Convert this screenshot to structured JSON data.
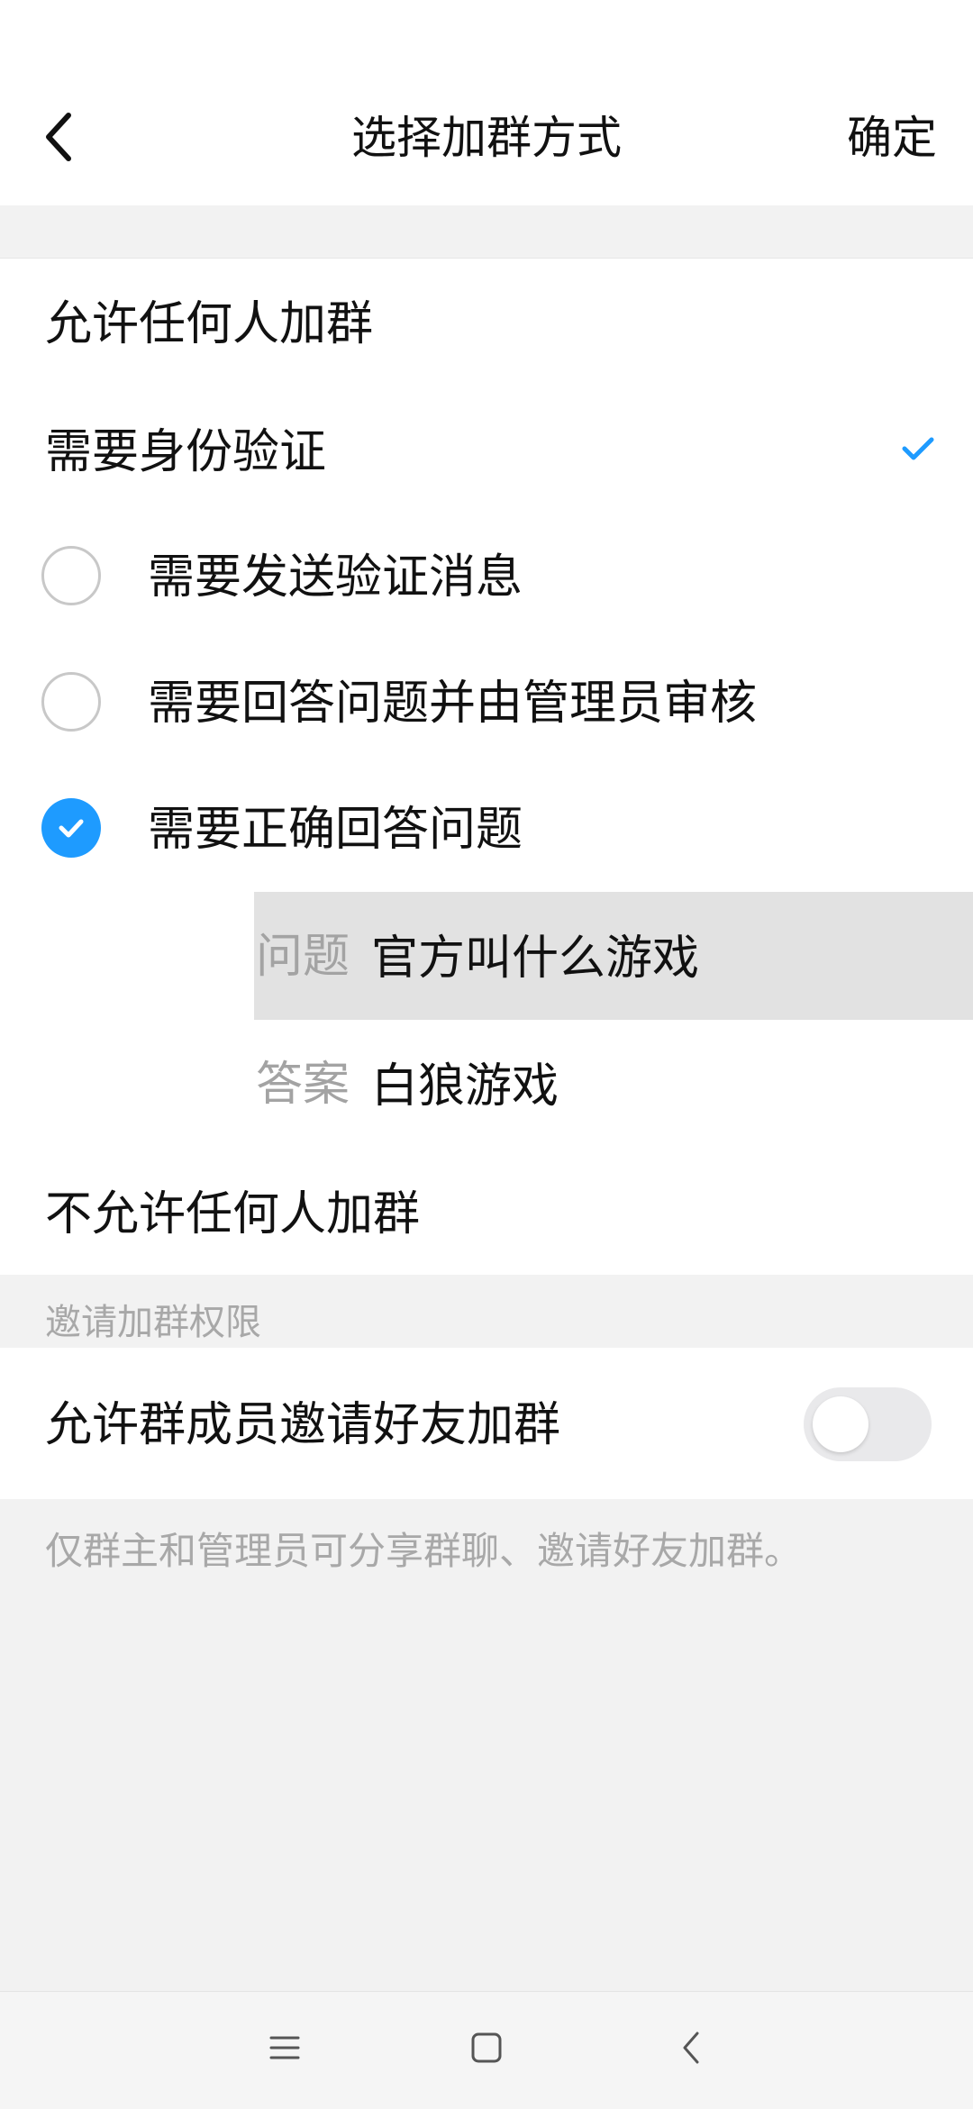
{
  "header": {
    "title": "选择加群方式",
    "confirm_label": "确定"
  },
  "join_options": {
    "allow_anyone": "允许任何人加群",
    "require_verification": "需要身份验证",
    "sub_options": [
      {
        "label": "需要发送验证消息",
        "checked": false
      },
      {
        "label": "需要回答问题并由管理员审核",
        "checked": false
      },
      {
        "label": "需要正确回答问题",
        "checked": true
      }
    ],
    "question_label": "问题",
    "question_value": "官方叫什么游戏",
    "answer_label": "答案",
    "answer_value": "白狼游戏",
    "disallow_all": "不允许任何人加群"
  },
  "invite": {
    "section_header": "邀请加群权限",
    "toggle_label": "允许群成员邀请好友加群",
    "toggle_on": false,
    "note": "仅群主和管理员可分享群聊、邀请好友加群。"
  },
  "colors": {
    "accent": "#1e9bff",
    "background": "#f2f2f2",
    "muted_text": "#a8a8a8"
  },
  "icons": [
    "back-arrow-icon",
    "checkmark-icon",
    "menu-lines-icon",
    "home-square-icon",
    "nav-back-icon"
  ]
}
